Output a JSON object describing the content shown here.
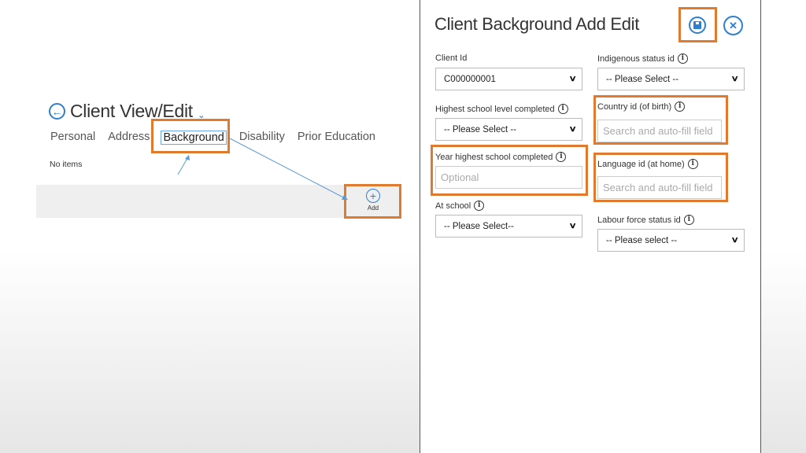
{
  "view": {
    "title": "Client View/Edit",
    "tabs": [
      "Personal",
      "Address",
      "Background",
      "Disability",
      "Prior Education"
    ],
    "active_tab": "Background",
    "empty_text": "No items",
    "add_label": "Add"
  },
  "panel": {
    "title": "Client Background Add Edit",
    "fields": {
      "client_id": {
        "label": "Client Id",
        "value": "C000000001"
      },
      "indigenous_status": {
        "label": "Indigenous status id",
        "value": "-- Please Select --"
      },
      "highest_school_level": {
        "label": "Highest school level completed",
        "value": "-- Please Select --"
      },
      "country_of_birth": {
        "label": "Country id (of birth)",
        "placeholder": "Search and auto-fill field"
      },
      "year_highest_school": {
        "label": "Year highest school completed",
        "placeholder": "Optional"
      },
      "language_at_home": {
        "label": "Language id (at home)",
        "placeholder": "Search and auto-fill field"
      },
      "at_school": {
        "label": "At school",
        "value": "-- Please Select--"
      },
      "labour_force_status": {
        "label": "Labour force status id",
        "value": "-- Please select --"
      }
    }
  },
  "icons": {
    "back": "back-arrow-icon",
    "chevron": "chevron-down-icon",
    "add": "plus-circle-icon",
    "save": "save-disk-icon",
    "close": "close-icon",
    "info": "info-icon"
  },
  "colors": {
    "accent": "#2f7fd0",
    "highlight": "#e07a2e"
  }
}
